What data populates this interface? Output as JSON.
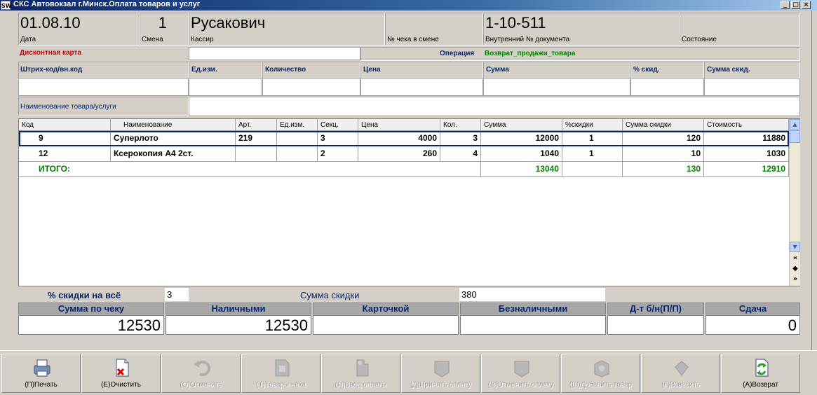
{
  "window": {
    "icon_text": "SW",
    "title": "СКС Автовокзал г.Минск.Оплата товаров и услуг",
    "min": "_",
    "max": "□",
    "close": "×"
  },
  "header": {
    "date_value": "01.08.10",
    "date_label": "Дата",
    "shift_value": "1",
    "shift_label": "Смена",
    "cashier_value": "Русакович",
    "cashier_label": "Кассир",
    "check_no_label": "№ чека в смене",
    "doc_value": "1-10-511",
    "doc_label": "Внутренний № документа",
    "state_label": "Состояние"
  },
  "discount_card": {
    "label": "Дисконтная карта",
    "value": ""
  },
  "operation": {
    "label": "Операция",
    "value": "Возврат_продажи_товара"
  },
  "entry_fields": {
    "barcode": "Штрих-код/вн.код",
    "unit": "Ед.изм.",
    "qty": "Количество",
    "price": "Цена",
    "sum": "Сумма",
    "disc_pct": "% скид.",
    "disc_sum": "Сумма скид.",
    "name": "Наименование товара/услуги"
  },
  "grid": {
    "columns": [
      "Код",
      "Наименование",
      "Арт.",
      "Ед.изм.",
      "Секц.",
      "Цена",
      "Кол.",
      "Сумма",
      "%скидки",
      "Сумма скидки",
      "Стоимость"
    ],
    "rows": [
      [
        "9",
        "Суперлото",
        "219",
        "",
        "3",
        "4000",
        "3",
        "12000",
        "1",
        "120",
        "11880"
      ],
      [
        "12",
        "Ксерокопия А4 2ст.",
        "",
        "",
        "2",
        "260",
        "4",
        "1040",
        "1",
        "10",
        "1030"
      ]
    ],
    "total": {
      "label": "ИТОГО:",
      "sum": "13040",
      "disc_sum": "130",
      "cost": "12910"
    },
    "scroll_up": "▲",
    "scroll_down": "▼",
    "nav_first": "«",
    "nav_mid": "◆",
    "nav_last": "»"
  },
  "summary": {
    "disc_all_label": "% скидки на всё",
    "disc_all_value": "3",
    "disc_sum_label": "Сумма скидки",
    "disc_sum_value": "380"
  },
  "payment": {
    "headers": [
      "Сумма по чеку",
      "Наличными",
      "Карточкой",
      "Безналичными",
      "Д-т б/н(П/П)",
      "Сдача"
    ],
    "values": [
      "12530",
      "12530",
      "",
      "",
      "",
      "0"
    ]
  },
  "toolbar": [
    {
      "label": "(П)Печать",
      "enabled": true
    },
    {
      "label": "(Е)Очистить",
      "enabled": true
    },
    {
      "label": "(О)Отменить",
      "enabled": false
    },
    {
      "label": "(Т)Товары чека",
      "enabled": false
    },
    {
      "label": "(Н)Ввод оплаты",
      "enabled": false
    },
    {
      "label": "(Д)Принять оплату",
      "enabled": false
    },
    {
      "label": "(В)Отменить оплату",
      "enabled": false
    },
    {
      "label": "(Ш)Добавить товар",
      "enabled": false
    },
    {
      "label": "(Г)Взвесить",
      "enabled": false
    },
    {
      "label": "(А)Возврат",
      "enabled": true
    }
  ],
  "colors": {
    "discount_label": "#d40000",
    "operation_label": "#0a246a",
    "operation_value": "#008000",
    "field_label": "#0a246a",
    "total": "#008000"
  }
}
